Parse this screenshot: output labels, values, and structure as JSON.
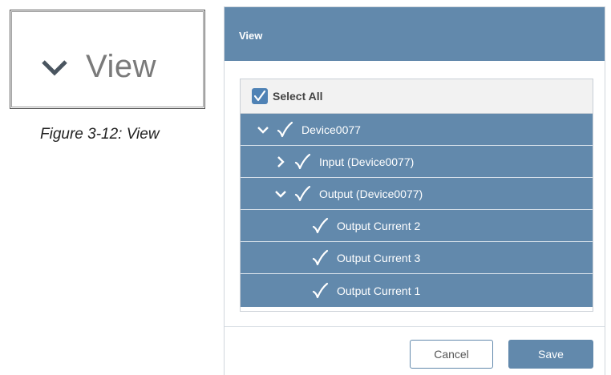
{
  "figure": {
    "label": "View",
    "caption": "Figure 3-12: View",
    "icon": "chevron-down-icon"
  },
  "dialog": {
    "title": "View",
    "select_all_label": "Select All",
    "select_all_checked": true,
    "tree": [
      {
        "label": "Device0077",
        "level": 0,
        "toggle": "chevron-down-icon",
        "checked": true
      },
      {
        "label": "Input (Device0077)",
        "level": 1,
        "toggle": "chevron-right-icon",
        "checked": true
      },
      {
        "label": "Output (Device0077)",
        "level": 1,
        "toggle": "chevron-down-icon",
        "checked": true
      },
      {
        "label": "Output Current 2",
        "level": 2,
        "toggle": "",
        "checked": true
      },
      {
        "label": "Output Current 3",
        "level": 2,
        "toggle": "",
        "checked": true
      },
      {
        "label": "Output Current 1",
        "level": 2,
        "toggle": "",
        "checked": true
      }
    ],
    "cancel_label": "Cancel",
    "save_label": "Save"
  },
  "colors": {
    "header": "#6289ac",
    "row": "#6289ac",
    "checkbox": "#4f82b5"
  }
}
